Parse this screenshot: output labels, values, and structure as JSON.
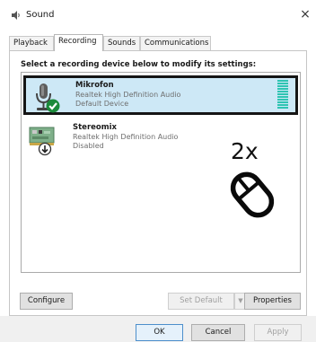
{
  "window": {
    "title": "Sound",
    "close_label": "×"
  },
  "tabs": [
    {
      "label": "Playback",
      "active": false
    },
    {
      "label": "Recording",
      "active": true
    },
    {
      "label": "Sounds",
      "active": false
    },
    {
      "label": "Communications",
      "active": false
    }
  ],
  "instruction": "Select a recording device below to modify its settings:",
  "devices": [
    {
      "name": "Mikrofon",
      "driver": "Realtek High Definition Audio",
      "status": "Default Device",
      "selected": true,
      "icon": "microphone-icon",
      "badge": "default-check-icon"
    },
    {
      "name": "Stereomix",
      "driver": "Realtek High Definition Audio",
      "status": "Disabled",
      "selected": false,
      "icon": "sound-card-icon",
      "badge": "disabled-arrow-icon"
    }
  ],
  "annotation": {
    "label": "2x",
    "icon": "mouse-icon"
  },
  "buttons": {
    "configure": "Configure",
    "set_default": "Set Default",
    "set_default_arrow": "▼",
    "properties": "Properties",
    "ok": "OK",
    "cancel": "Cancel",
    "apply": "Apply"
  },
  "colors": {
    "selection": "#cde8f6",
    "check_badge": "#1b8a3a",
    "level_meter": "#2fc4b2"
  }
}
